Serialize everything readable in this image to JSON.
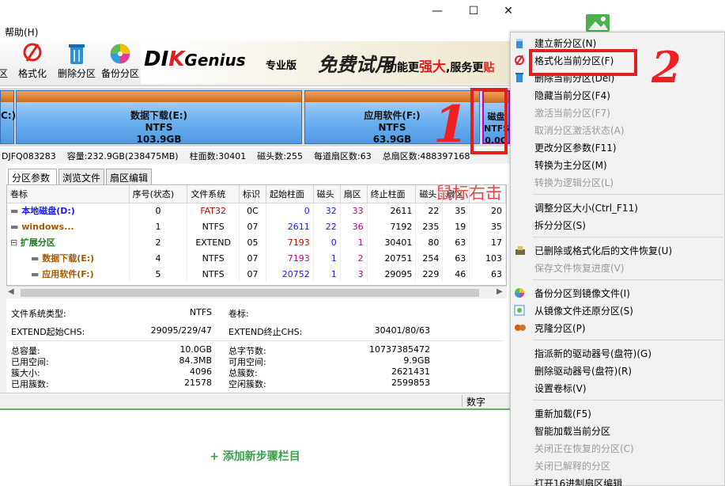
{
  "window": {
    "minimize_glyph": "—",
    "maximize_glyph": "☐",
    "close_glyph": "✕",
    "menu": {
      "help": "帮助(H)"
    }
  },
  "toolbar": {
    "edge_label": "区",
    "items": [
      {
        "label": "格式化",
        "icon": "format-icon"
      },
      {
        "label": "删除分区",
        "icon": "trash-icon"
      },
      {
        "label": "备份分区",
        "icon": "backup-icon"
      }
    ],
    "banner": {
      "brand_di": "DI",
      "brand_k": "K",
      "brand_genius": "Genius",
      "edition": "专业版",
      "promo": "免费试用",
      "slogan_pre": "功能更",
      "slogan_strong": "强大",
      "slogan_post": ",服务更",
      "slogan_tail": "贴"
    }
  },
  "diskmap": {
    "left_edge_label": "C:)",
    "partitions": [
      {
        "name": "数据下载(E:)",
        "fs": "NTFS",
        "size": "103.9GB"
      },
      {
        "name": "应用软件(F:)",
        "fs": "NTFS",
        "size": "63.9GB"
      },
      {
        "name": "磁盘",
        "fs": "NTFS",
        "size": "0.0G"
      }
    ]
  },
  "diskinfo": {
    "serial": "DJFQ083283",
    "capacity": "容量:232.9GB(238475MB)",
    "cylinders": "柱面数:30401",
    "heads": "磁头数:255",
    "sectors_per_track": "每道扇区数:63",
    "total_sectors": "总扇区数:488397168"
  },
  "tabs": [
    "分区参数",
    "浏览文件",
    "扇区编辑"
  ],
  "table": {
    "columns": [
      "卷标",
      "序号(状态)",
      "文件系统",
      "标识",
      "起始柱面",
      "磁头",
      "扇区",
      "终止柱面",
      "磁头",
      "扇区",
      ""
    ],
    "rows": [
      {
        "name": "本地磁盘(D:)",
        "idx": "0",
        "fs": "FAT32",
        "id": "0C",
        "sc": "0",
        "sh": "32",
        "ss": "33",
        "ec": "2611",
        "eh": "22",
        "es": "35",
        "cap": "20"
      },
      {
        "name": "windows...",
        "idx": "1",
        "fs": "NTFS",
        "id": "07",
        "sc": "2611",
        "sh": "22",
        "ss": "36",
        "ec": "7192",
        "eh": "235",
        "es": "19",
        "cap": "35"
      },
      {
        "name": "扩展分区",
        "idx": "2",
        "fs": "EXTEND",
        "id": "05",
        "sc": "7193",
        "sh": "0",
        "ss": "1",
        "ec": "30401",
        "eh": "80",
        "es": "63",
        "cap": "17"
      },
      {
        "name": "数据下载(E:)",
        "idx": "4",
        "fs": "NTFS",
        "id": "07",
        "sc": "7193",
        "sh": "1",
        "ss": "2",
        "ec": "20751",
        "eh": "254",
        "es": "63",
        "cap": "103"
      },
      {
        "name": "应用软件(F:)",
        "idx": "5",
        "fs": "NTFS",
        "id": "07",
        "sc": "20752",
        "sh": "1",
        "ss": "3",
        "ec": "29095",
        "eh": "229",
        "es": "46",
        "cap": "63"
      }
    ]
  },
  "details": {
    "fs_type_label": "文件系统类型:",
    "fs_type_value": "NTFS",
    "volume_label": "卷标:",
    "extend_start_label": "EXTEND起始CHS:",
    "extend_start_value": "29095/229/47",
    "extend_end_label": "EXTEND终止CHS:",
    "extend_end_value": "30401/80/63",
    "total_cap_label": "总容量:",
    "total_cap_value": "10.0GB",
    "used_label": "已用空间:",
    "used_value": "84.3MB",
    "cluster_size_label": "簇大小:",
    "cluster_size_value": "4096",
    "used_clusters_label": "已用簇数:",
    "used_clusters_value": "21578",
    "total_bytes_label": "总字节数:",
    "total_bytes_value": "10737385472",
    "free_label": "可用空间:",
    "free_value": "9.9GB",
    "total_clusters_label": "总簇数:",
    "total_clusters_value": "2621431",
    "free_clusters_label": "空闲簇数:",
    "free_clusters_value": "2599853"
  },
  "statusbar": {
    "mode": "数字"
  },
  "webpage": {
    "add_step": "+ 添加新步骤栏目"
  },
  "context_menu": {
    "items": [
      {
        "label": "建立新分区(N)",
        "enabled": true,
        "icon": "new-partition-icon"
      },
      {
        "label": "格式化当前分区(F)",
        "enabled": true,
        "icon": "format-icon"
      },
      {
        "label": "删除当前分区(Del)",
        "enabled": true,
        "icon": "trash-icon"
      },
      {
        "label": "隐藏当前分区(F4)",
        "enabled": true
      },
      {
        "label": "激活当前分区(F7)",
        "enabled": false
      },
      {
        "label": "取消分区激活状态(A)",
        "enabled": false
      },
      {
        "label": "更改分区参数(F11)",
        "enabled": true
      },
      {
        "label": "转换为主分区(M)",
        "enabled": true
      },
      {
        "label": "转换为逻辑分区(L)",
        "enabled": false
      },
      {
        "label": "调整分区大小(Ctrl_F11)",
        "enabled": true
      },
      {
        "label": "拆分分区(S)",
        "enabled": true
      },
      {
        "label": "已删除或格式化后的文件恢复(U)",
        "enabled": true,
        "icon": "recover-icon"
      },
      {
        "label": "保存文件恢复进度(V)",
        "enabled": false
      },
      {
        "label": "备份分区到镜像文件(I)",
        "enabled": true,
        "icon": "backup-icon"
      },
      {
        "label": "从镜像文件还原分区(S)",
        "enabled": true,
        "icon": "restore-icon"
      },
      {
        "label": "克隆分区(P)",
        "enabled": true,
        "icon": "clone-icon"
      },
      {
        "label": "指派新的驱动器号(盘符)(G)",
        "enabled": true
      },
      {
        "label": "删除驱动器号(盘符)(R)",
        "enabled": true
      },
      {
        "label": "设置卷标(V)",
        "enabled": true
      },
      {
        "label": "重新加载(F5)",
        "enabled": true
      },
      {
        "label": "智能加载当前分区",
        "enabled": true
      },
      {
        "label": "关闭正在恢复的分区(C)",
        "enabled": false
      },
      {
        "label": "关闭已解释的分区",
        "enabled": false
      },
      {
        "label": "打开16进制扇区编辑",
        "enabled": true
      }
    ]
  },
  "annotations": {
    "step1": "1",
    "step2": "2",
    "right_click_text": "鼠标右击"
  },
  "colors": {
    "annotation_red": "#e02020",
    "partition_blue": "#6fb2f0",
    "partition_orange": "#d97a2b",
    "add_step_green": "#3aa04a"
  }
}
